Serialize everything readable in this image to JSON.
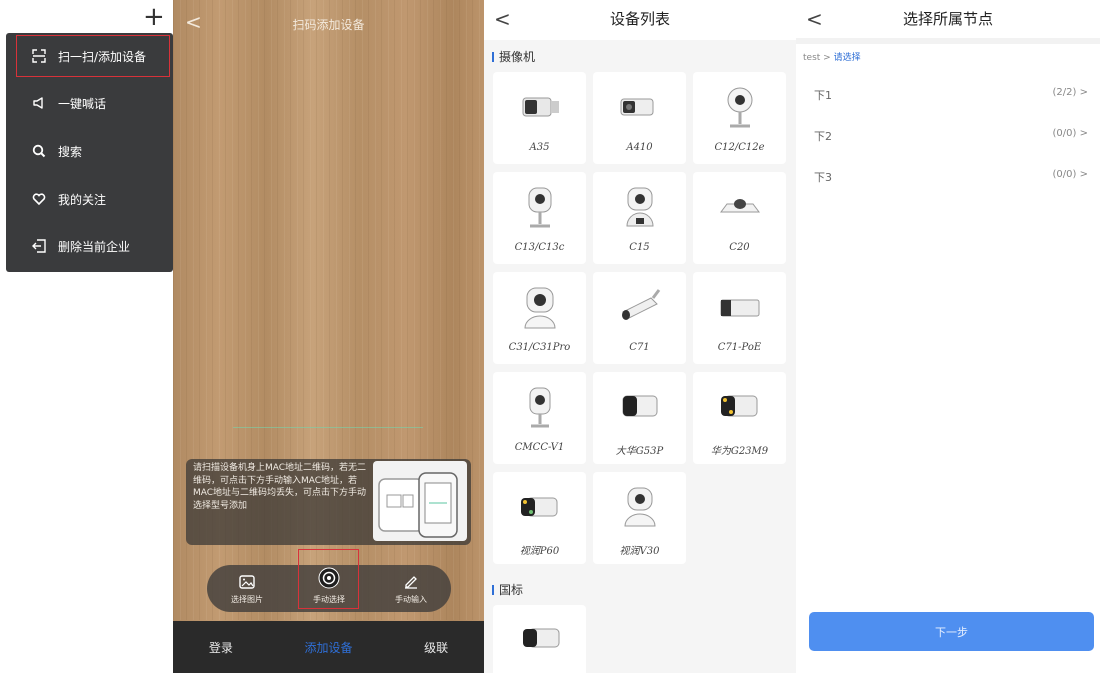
{
  "menu": {
    "plus": "+",
    "items": [
      {
        "label": "扫一扫/添加设备",
        "icon": "scan-icon"
      },
      {
        "label": "一键喊话",
        "icon": "speaker-icon"
      },
      {
        "label": "搜索",
        "icon": "search-icon"
      },
      {
        "label": "我的关注",
        "icon": "heart-icon"
      },
      {
        "label": "删除当前企业",
        "icon": "exit-icon"
      }
    ]
  },
  "scan": {
    "back": "<",
    "title": "扫码添加设备",
    "hint": "请扫描设备机身上MAC地址二维码，若无二维码，可点击下方手动输入MAC地址，若MAC地址与二维码均丢失，可点击下方手动选择型号添加",
    "tools": [
      {
        "label": "选择图片",
        "icon": "image-icon"
      },
      {
        "label": "手动选择",
        "icon": "camera-lens-icon"
      },
      {
        "label": "手动输入",
        "icon": "pencil-icon"
      }
    ],
    "tabs": [
      {
        "label": "登录",
        "active": false
      },
      {
        "label": "添加设备",
        "active": true
      },
      {
        "label": "级联",
        "active": false
      }
    ],
    "colors": {
      "accent": "#2f6fd6",
      "highlight": "#d8323a"
    }
  },
  "devices": {
    "back": "<",
    "title": "设备列表",
    "section_camera": "摄像机",
    "section_gb": "国标",
    "cameras": [
      "A35",
      "A410",
      "C12/C12e",
      "C13/C13c",
      "C15",
      "C20",
      "C31/C31Pro",
      "C71",
      "C71-PoE",
      "CMCC-V1",
      "大华G53P",
      "华为G23M9",
      "视润P60",
      "视润V30"
    ],
    "gb": [
      ""
    ]
  },
  "node": {
    "back": "<",
    "title": "选择所属节点",
    "crumb_root": "test",
    "crumb_sep": ">",
    "crumb_sel": "请选择",
    "rows": [
      {
        "name": "下1",
        "count": "(2/2)",
        "arrow": ">"
      },
      {
        "name": "下2",
        "count": "(0/0)",
        "arrow": ">"
      },
      {
        "name": "下3",
        "count": "(0/0)",
        "arrow": ">"
      }
    ],
    "next": "下一步",
    "colors": {
      "button": "#4f8ff0"
    }
  }
}
